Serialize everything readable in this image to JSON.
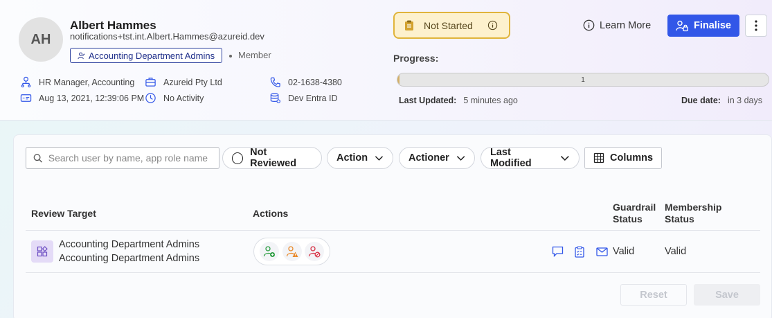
{
  "user": {
    "initials": "AH",
    "name": "Albert Hammes",
    "email": "notifications+tst.int.Albert.Hammes@azureid.dev",
    "group": "Accounting Department Admins",
    "role": "Member"
  },
  "details": {
    "job_title": "HR Manager, Accounting",
    "company": "Azureid Pty Ltd",
    "phone": "02-1638-4380",
    "created": "Aug 13, 2021, 12:39:06 PM",
    "activity": "No Activity",
    "source": "Dev Entra ID"
  },
  "status": {
    "label": "Not Started",
    "color": "#e0b43a"
  },
  "actions": {
    "learn_more": "Learn More",
    "finalise": "Finalise"
  },
  "progress": {
    "label": "Progress:",
    "value_text": "1",
    "fraction": 0.005,
    "last_updated_label": "Last Updated:",
    "last_updated_value": "5 minutes ago",
    "due_label": "Due date:",
    "due_value": "in 3 days"
  },
  "toolbar": {
    "search_placeholder": "Search user by name, app role name",
    "filters": [
      "Not Reviewed",
      "Action",
      "Actioner",
      "Last Modified"
    ],
    "columns": "Columns"
  },
  "table": {
    "headers": {
      "review_target": "Review Target",
      "actions": "Actions",
      "guardrail_line1": "Guardrail",
      "guardrail_line2": "Status",
      "membership_line1": "Membership",
      "membership_line2": "Status"
    },
    "rows": [
      {
        "title": "Accounting Department Admins",
        "subtitle": "Accounting Department Admins",
        "guardrail_status": "Valid",
        "membership_status": "Valid"
      }
    ]
  },
  "footer": {
    "reset": "Reset",
    "save": "Save"
  },
  "colors": {
    "primary": "#3257e8",
    "status_bg": "#fdf1cd",
    "approve": "#2f9e44",
    "warn": "#e8892b",
    "revoke": "#d63447"
  }
}
